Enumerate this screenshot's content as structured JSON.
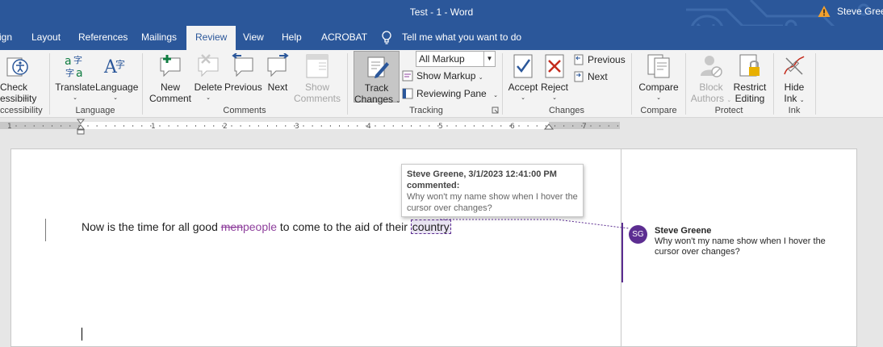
{
  "window": {
    "title": "Test - 1  -  Word",
    "user_name": "Steve Greene",
    "warning_icon": "warning-icon"
  },
  "tabs": [
    "ign",
    "Layout",
    "References",
    "Mailings",
    "Review",
    "View",
    "Help",
    "ACROBAT"
  ],
  "active_tab": "Review",
  "tell_me": "Tell me what you want to do",
  "ribbon": {
    "accessibility": {
      "label_line1": "Check",
      "label_line2": "essibility",
      "group": "ccessibility"
    },
    "language": {
      "translate": "Translate",
      "language": "Language",
      "group": "Language"
    },
    "comments": {
      "new_line1": "New",
      "new_line2": "Comment",
      "delete": "Delete",
      "previous": "Previous",
      "next": "Next",
      "show_line1": "Show",
      "show_line2": "Comments",
      "group": "Comments"
    },
    "tracking": {
      "track_line1": "Track",
      "track_line2": "Changes",
      "markup_dropdown": "All Markup",
      "show_markup": "Show Markup",
      "reviewing_pane": "Reviewing Pane",
      "group": "Tracking"
    },
    "changes": {
      "accept": "Accept",
      "reject": "Reject",
      "previous": "Previous",
      "next": "Next",
      "group": "Changes"
    },
    "compare": {
      "compare": "Compare",
      "group": "Compare"
    },
    "protect": {
      "block_line1": "Block",
      "block_line2": "Authors",
      "restrict_line1": "Restrict",
      "restrict_line2": "Editing",
      "group": "Protect"
    },
    "ink": {
      "hide_line1": "Hide",
      "hide_line2": "Ink",
      "group": "Ink"
    }
  },
  "ruler": {
    "numbers": [
      "1",
      "1",
      "2",
      "3",
      "4",
      "5",
      "6",
      "7"
    ]
  },
  "document": {
    "text_before": "Now is the time for all good ",
    "deleted": "men",
    "inserted": "people",
    "text_middle": " to come to the aid of their ",
    "commented_word": "country"
  },
  "tooltip": {
    "header": "Steve Greene, 3/1/2023 12:41:00 PM",
    "action": "commented:",
    "text": "Why won't my name show when I hover the cursor over changes?"
  },
  "comment": {
    "initials": "SG",
    "author": "Steve Greene",
    "text": "Why won't my name show when I hover the cursor over changes?",
    "color": "#5c2d91"
  },
  "colors": {
    "title_bar": "#2b579a",
    "revision": "#8e3f9c"
  }
}
